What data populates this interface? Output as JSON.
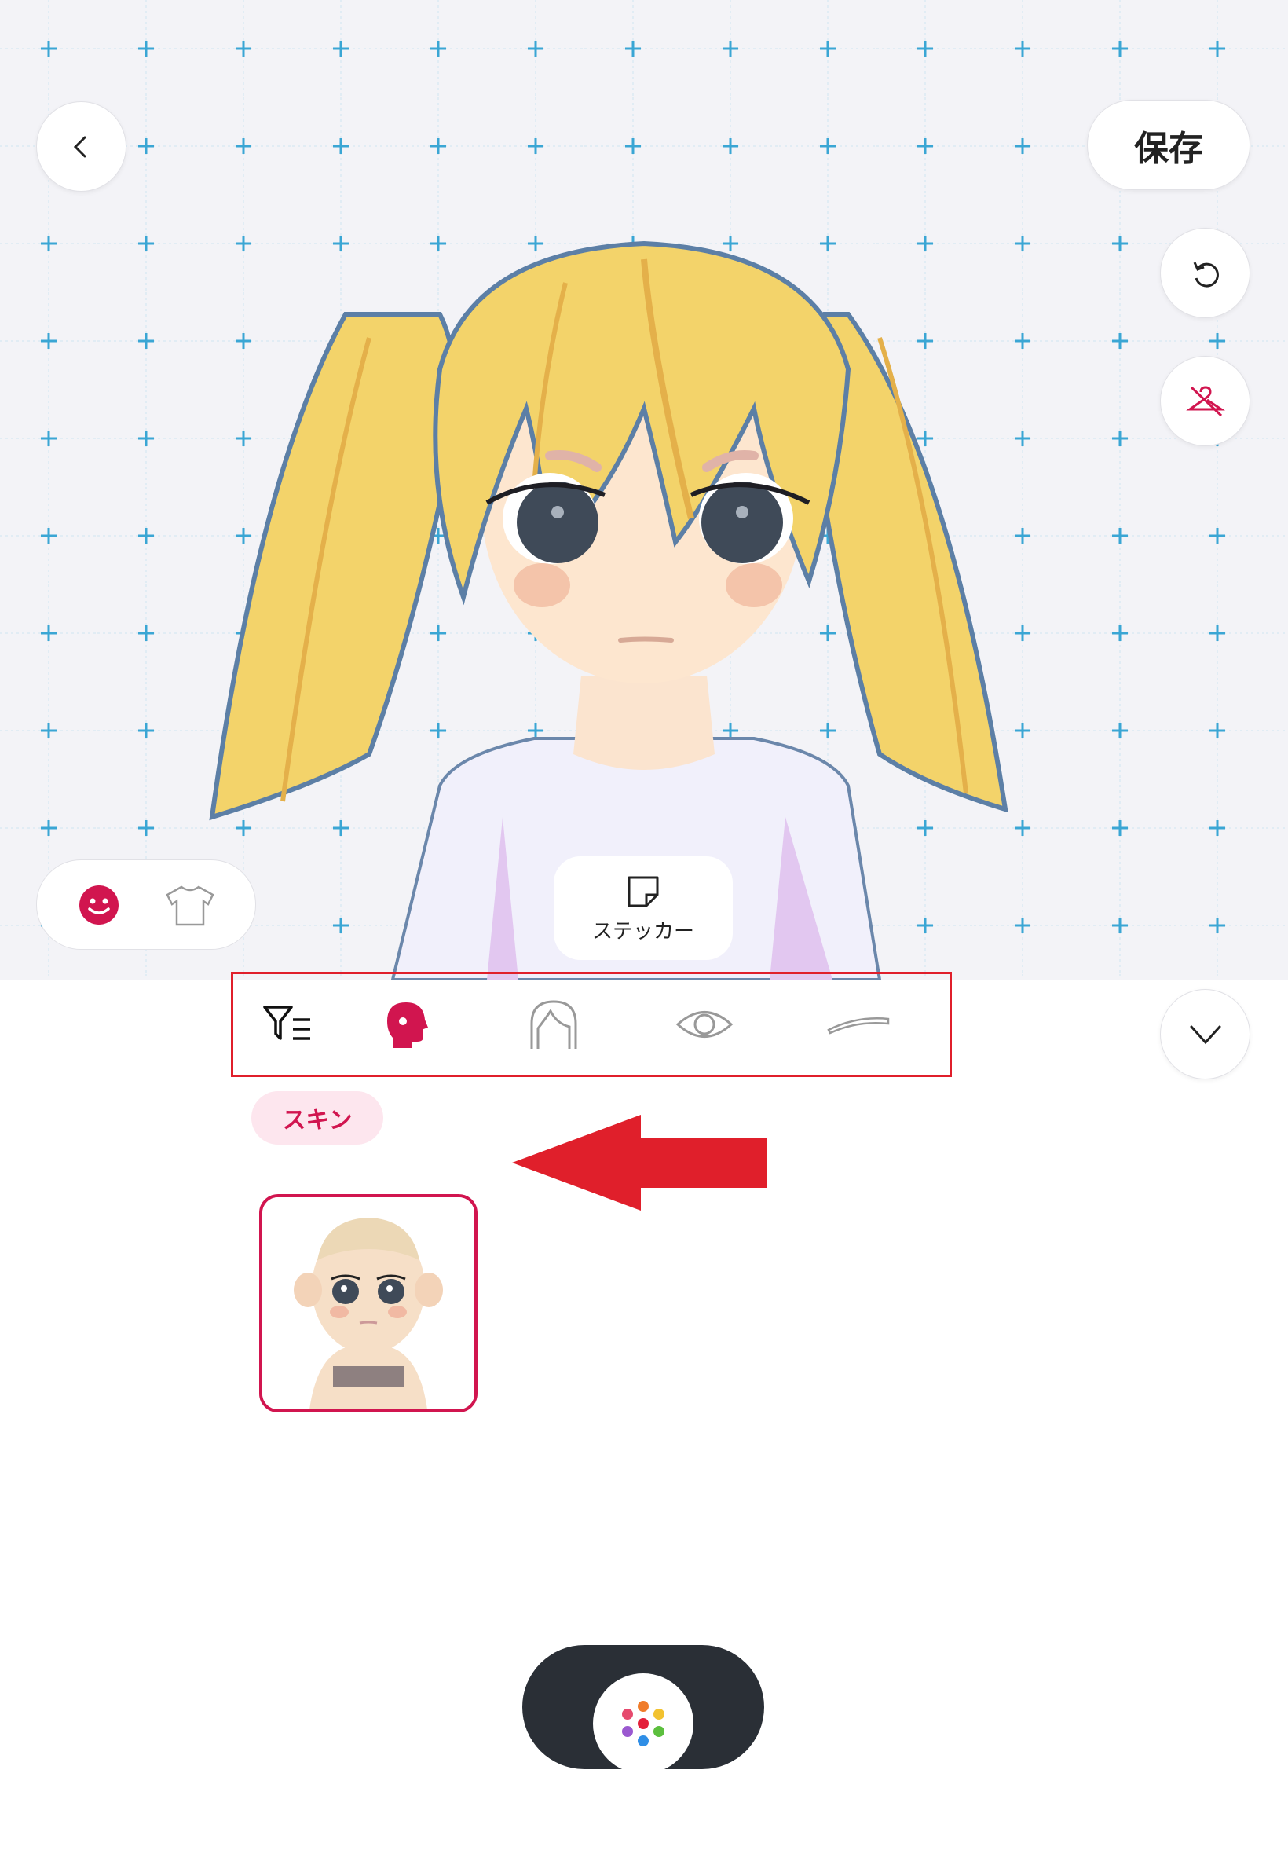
{
  "toolbar": {
    "save_label": "保存"
  },
  "canvas": {
    "sticker_label": "ステッカー"
  },
  "tabs": [
    {
      "name": "filter",
      "icon": "filter-list-icon",
      "active": false
    },
    {
      "name": "face",
      "icon": "head-profile-icon",
      "active": true
    },
    {
      "name": "hair",
      "icon": "hair-icon",
      "active": false
    },
    {
      "name": "eye",
      "icon": "eye-icon",
      "active": false
    },
    {
      "name": "eyebrow",
      "icon": "eyebrow-icon",
      "active": false
    }
  ],
  "category": {
    "chip_label": "スキン"
  },
  "colors": {
    "accent": "#d1154f",
    "annotation": "#e01f2b",
    "hair": "#f3d36a",
    "dock": "#2a2f36"
  }
}
